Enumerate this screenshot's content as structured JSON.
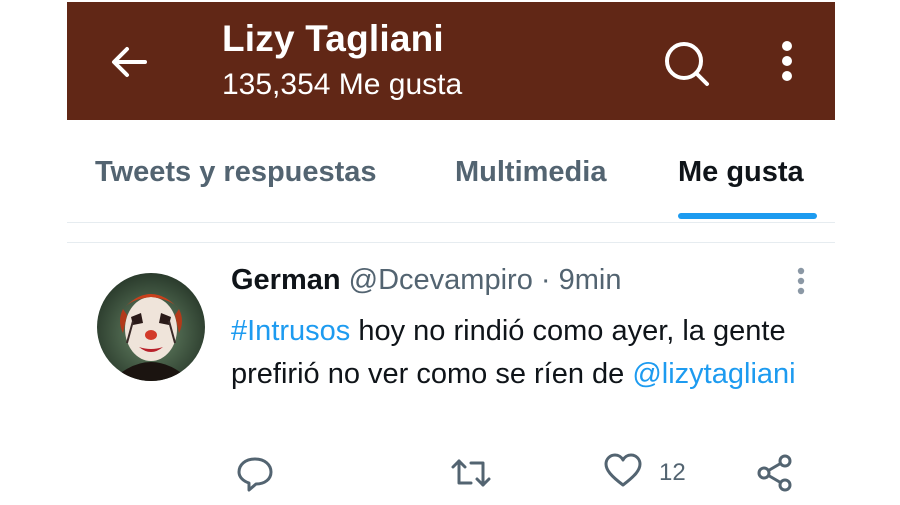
{
  "header": {
    "title": "Lizy Tagliani",
    "subtitle": "135,354 Me gusta",
    "icons": [
      "back-arrow-icon",
      "search-icon",
      "more-vertical-icon"
    ]
  },
  "tabs": [
    {
      "label": "Tweets y respuestas",
      "active": false
    },
    {
      "label": "Multimedia",
      "active": false
    },
    {
      "label": "Me gusta",
      "active": true
    }
  ],
  "tweet": {
    "author": "German",
    "handle": "@Dcevampiro",
    "separator": "·",
    "time": "9min",
    "hashtag": "#Intrusos",
    "text_part": " hoy no rindió como ayer, la gente prefirió no ver como se ríen de ",
    "mention": "@lizytagliani",
    "like_count": "12",
    "action_icons": [
      "reply-icon",
      "retweet-icon",
      "heart-icon",
      "share-icon"
    ]
  },
  "colors": {
    "header_bg": "#612716",
    "accent": "#1d9bf0",
    "secondary_text": "#536471"
  }
}
